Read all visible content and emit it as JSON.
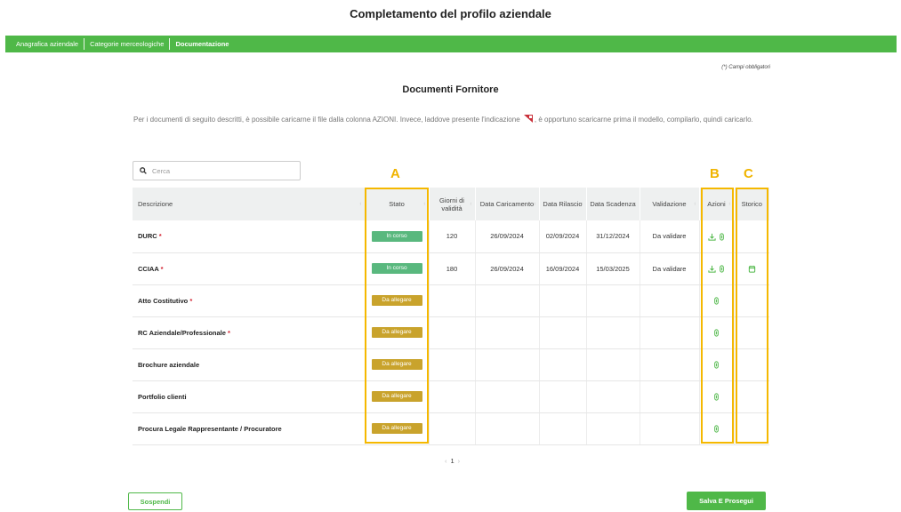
{
  "page_title": "Completamento del profilo aziendale",
  "nav": {
    "items": [
      {
        "label": "Anagrafica aziendale",
        "active": false
      },
      {
        "label": "Categorie merceologiche",
        "active": false
      },
      {
        "label": "Documentazione",
        "active": true
      }
    ]
  },
  "required_note": "(*) Campi obbligatori",
  "section_title": "Documenti Fornitore",
  "intro": {
    "part1": "Per i documenti di seguito descritti, è possibile caricarne il file dalla colonna AZIONI. Invece, laddove presente l'indicazione",
    "part2": ", è opportuno scaricarne prima il modello, compilarlo, quindi caricarlo."
  },
  "search": {
    "placeholder": "Cerca",
    "value": ""
  },
  "annotations": {
    "a": "A",
    "b": "B",
    "c": "C"
  },
  "table": {
    "headers": {
      "descrizione": "Descrizione",
      "stato": "Stato",
      "giorni": "Giorni di validità",
      "caricamento": "Data Caricamento",
      "rilascio": "Data Rilascio",
      "scadenza": "Data Scadenza",
      "validazione": "Validazione",
      "azioni": "Azioni",
      "storico": "Storico"
    },
    "rows": [
      {
        "desc": "DURC",
        "required": "*",
        "stato": "In corso",
        "giorni": "120",
        "caricamento": "26/09/2024",
        "rilascio": "02/09/2024",
        "scadenza": "31/12/2024",
        "validazione": "Da validare"
      },
      {
        "desc": "CCIAA",
        "required": "*",
        "stato": "In corso",
        "giorni": "180",
        "caricamento": "26/09/2024",
        "rilascio": "16/09/2024",
        "scadenza": "15/03/2025",
        "validazione": "Da validare"
      },
      {
        "desc": "Atto Costitutivo",
        "required": "*",
        "stato": "Da allegare",
        "giorni": "",
        "caricamento": "",
        "rilascio": "",
        "scadenza": "",
        "validazione": ""
      },
      {
        "desc": "RC Aziendale/Professionale",
        "required": "*",
        "stato": "Da allegare",
        "giorni": "",
        "caricamento": "",
        "rilascio": "",
        "scadenza": "",
        "validazione": ""
      },
      {
        "desc": "Brochure aziendale",
        "required": "",
        "stato": "Da allegare",
        "giorni": "",
        "caricamento": "",
        "rilascio": "",
        "scadenza": "",
        "validazione": ""
      },
      {
        "desc": "Portfolio clienti",
        "required": "",
        "stato": "Da allegare",
        "giorni": "",
        "caricamento": "",
        "rilascio": "",
        "scadenza": "",
        "validazione": ""
      },
      {
        "desc": "Procura Legale Rappresentante / Procuratore",
        "required": "",
        "stato": "Da allegare",
        "giorni": "",
        "caricamento": "",
        "rilascio": "",
        "scadenza": "",
        "validazione": ""
      }
    ]
  },
  "pagination": {
    "current": "1",
    "prev": "‹",
    "next": "›"
  },
  "buttons": {
    "suspend": "Sospendi",
    "save": "Salva E Prosegui"
  },
  "colors": {
    "brand_green": "#4fb848",
    "status_in_corso": "#59b87e",
    "status_da_allegare": "#c9a32c",
    "annotation": "#f5b800",
    "required": "#d2202f"
  },
  "icons": {
    "search": "search-icon",
    "download": "download-icon",
    "attach": "paperclip-icon",
    "history": "calendar-icon",
    "template": "template-flag-icon"
  }
}
